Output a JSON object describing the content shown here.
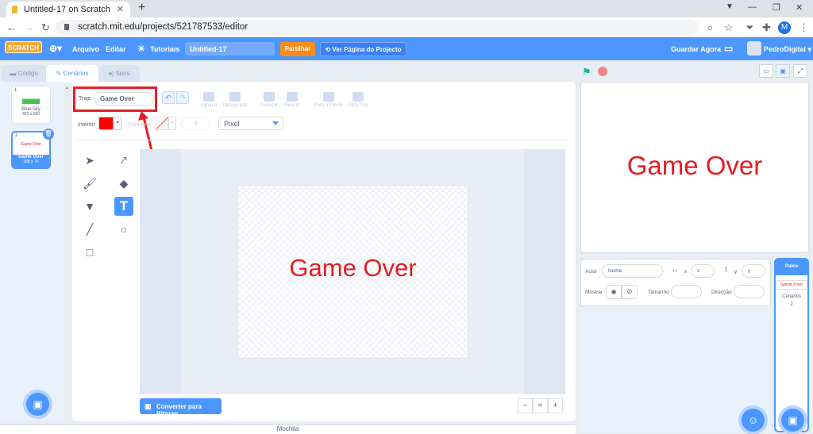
{
  "browser": {
    "tab_title": "Untitled-17 on Scratch",
    "url": "scratch.mit.edu/projects/521787533/editor",
    "profile_initial": "M"
  },
  "menubar": {
    "logo": "SCRATCH",
    "language": "",
    "file": "Arquivo",
    "edit": "Editar",
    "tutorials": "Tutoriais",
    "project_title": "Untitled-17",
    "share": "Partilhar",
    "see_project": "Ver Página do Projecto",
    "save_now": "Guardar Agora",
    "username": "PedroDigital"
  },
  "tabs": {
    "code": "Código",
    "costumes": "Cenários",
    "sounds": "Sons"
  },
  "costumes": [
    {
      "index": "1",
      "name": "Blue Sky",
      "size": "480 x 360"
    },
    {
      "index": "2",
      "name": "Game Over",
      "size": "288 x 76",
      "thumb_text": "Game Over"
    }
  ],
  "paint": {
    "costume_label": "Traje",
    "costume_name": "Game Over",
    "group": "Agrupar",
    "ungroup": "Desagrupar",
    "forward": "Avançar",
    "backward": "Recuar",
    "front": "Para a Frente",
    "back": "Para Trás",
    "fill_label": "Interior",
    "fill_color": "#ff0000",
    "outline_label": "Contorno",
    "outline_size": "0",
    "mode": "Pixel",
    "canvas_text": "Game Over",
    "convert_button": "Converter para Bitmap",
    "zoom_out": "−",
    "zoom_reset": "=",
    "zoom_in": "+"
  },
  "tools": [
    "select-icon",
    "reshape-icon",
    "brush-icon",
    "eraser-icon",
    "fill-icon",
    "text-icon",
    "line-icon",
    "circle-icon",
    "rectangle-icon"
  ],
  "stage": {
    "text": "Game Over",
    "text_color": "#e31e24"
  },
  "sprite_info": {
    "sprite_label": "Actor",
    "name_placeholder": "Nome",
    "x_label": "x",
    "x_placeholder": "x",
    "y_label": "y",
    "y_placeholder": "y",
    "show_label": "Mostrar",
    "size_label": "Tamanho",
    "direction_label": "Direcção"
  },
  "stage_panel": {
    "header": "Palco",
    "thumb_text": "Game Over",
    "backdrops_label": "Cenários",
    "backdrops_count": "2"
  },
  "backpack": "Mochila",
  "colors": {
    "accent": "#4c97ff",
    "share": "#ff8c1a",
    "highlight": "#e41f26"
  }
}
